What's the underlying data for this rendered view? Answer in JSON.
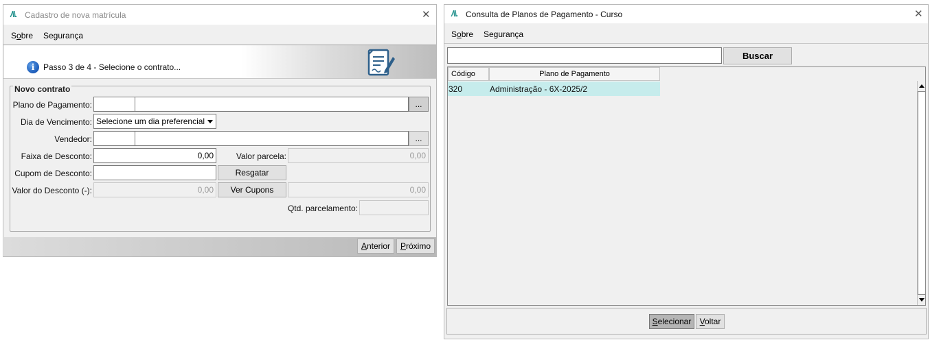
{
  "window1": {
    "title": "Cadastro de nova matrícula",
    "menu": {
      "sobre_pre": "S",
      "sobre_ul": "o",
      "sobre_post": "bre",
      "seguranca": "Segurança"
    },
    "step_text": "Passo 3 de 4 - Selecione o contrato...",
    "group_title": "Novo contrato",
    "labels": {
      "plano": "Plano de Pagamento:",
      "dia": "Dia de Vencimento:",
      "vendedor": "Vendedor:",
      "faixa": "Faixa de Desconto:",
      "valor_parcela": "Valor parcela:",
      "cupom": "Cupom de Desconto:",
      "valor_desconto": "Valor do Desconto (-):",
      "qtd": "Qtd. parcelamento:"
    },
    "values": {
      "dia_select": "Selecione um dia preferencial",
      "faixa": "0,00",
      "valor_parcela": "0,00",
      "valor_desconto": "0,00",
      "cupons_total": "0,00"
    },
    "buttons": {
      "ellipsis": "...",
      "resgatar": "Resgatar",
      "ver_cupons": "Ver Cupons",
      "anterior_ul": "A",
      "anterior_rest": "nterior",
      "proximo_ul": "P",
      "proximo_rest": "róximo"
    }
  },
  "window2": {
    "title": "Consulta de Planos de Pagamento - Curso",
    "menu": {
      "sobre_pre": "S",
      "sobre_ul": "o",
      "sobre_post": "bre",
      "seguranca": "Segurança"
    },
    "search_value": "",
    "buscar": "Buscar",
    "columns": [
      "Código",
      "Plano de Pagamento"
    ],
    "rows": [
      {
        "codigo": "320",
        "plano": "Administração - 6X-2025/2"
      }
    ],
    "buttons": {
      "selecionar_ul": "S",
      "selecionar_rest": "elecionar",
      "voltar_ul": "V",
      "voltar_rest": "oltar"
    }
  },
  "icons": {
    "app_logo": "app-logo-icon",
    "close": "close-icon",
    "info": "info-icon",
    "document_edit": "document-edit-icon"
  },
  "colors": {
    "selected_row": "#c6ecec",
    "logo": "#1e8f8a",
    "info_blue": "#1c5bb8"
  }
}
